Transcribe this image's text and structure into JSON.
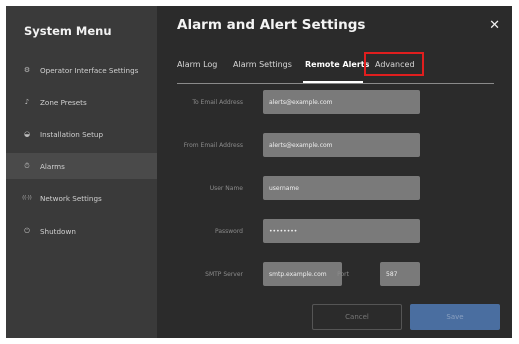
{
  "sidebar": {
    "title": "System Menu",
    "items": [
      {
        "label": "Operator Interface Settings",
        "icon": "⚙"
      },
      {
        "label": "Zone Presets",
        "icon": "♪"
      },
      {
        "label": "Installation Setup",
        "icon": "◒"
      },
      {
        "label": "Alarms",
        "icon": "⏱"
      },
      {
        "label": "Network Settings",
        "icon": "((·))"
      },
      {
        "label": "Shutdown",
        "icon": "⏻"
      }
    ],
    "active_index": 3
  },
  "header": {
    "title": "Alarm and Alert Settings",
    "close_label": "✕"
  },
  "tabs": [
    {
      "label": "Alarm Log"
    },
    {
      "label": "Alarm Settings"
    },
    {
      "label": "Remote Alerts"
    },
    {
      "label": "Advanced"
    }
  ],
  "active_tab": "Remote Alerts",
  "highlighted_tab": "Advanced",
  "form": {
    "to_email_label": "To Email Address",
    "to_email_value": "alerts@example.com",
    "from_email_label": "From Email Address",
    "from_email_value": "alerts@example.com",
    "username_label": "User Name",
    "username_value": "username",
    "password_label": "Password",
    "password_value": "••••••••",
    "smtp_label": "SMTP Server",
    "smtp_value": "smtp.example.com",
    "port_label": "Port",
    "port_value": "587"
  },
  "buttons": {
    "cancel": "Cancel",
    "save": "Save"
  },
  "colors": {
    "highlight": "#e01e1e",
    "save_button": "#4a6ea0"
  }
}
